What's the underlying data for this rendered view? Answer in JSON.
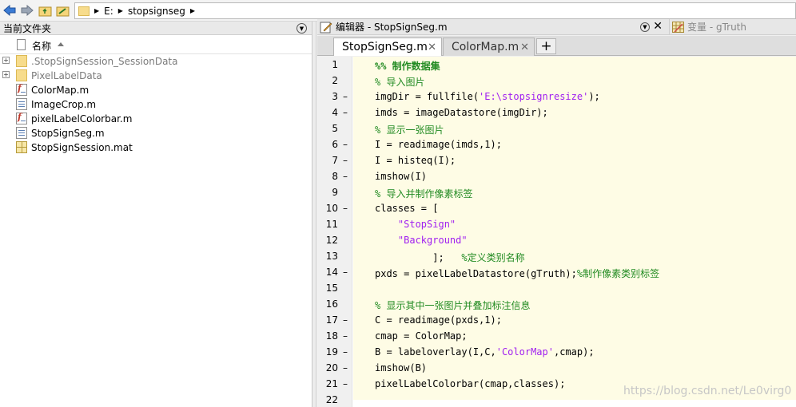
{
  "address_bar": {
    "path": [
      "E:",
      "stopsignseg"
    ]
  },
  "current_folder": {
    "title": "当前文件夹",
    "column_name": "名称",
    "files": [
      {
        "name": ".StopSignSession_SessionData",
        "type": "folder",
        "expandable": true,
        "dim": true
      },
      {
        "name": "PixelLabelData",
        "type": "folder",
        "expandable": true,
        "dim": true
      },
      {
        "name": "ColorMap.m",
        "type": "function-m"
      },
      {
        "name": "ImageCrop.m",
        "type": "script-m"
      },
      {
        "name": "pixelLabelColorbar.m",
        "type": "function-m"
      },
      {
        "name": "StopSignSeg.m",
        "type": "script-m"
      },
      {
        "name": "StopSignSession.mat",
        "type": "mat"
      }
    ]
  },
  "editor": {
    "title": "编辑器 - StopSignSeg.m",
    "tabs": [
      {
        "label": "StopSignSeg.m",
        "active": true
      },
      {
        "label": "ColorMap.m",
        "active": false
      }
    ],
    "add_tab": "+"
  },
  "variables_panel": {
    "title": "变量 - gTruth"
  },
  "code": {
    "lines": [
      {
        "n": "1",
        "dash": "",
        "src": "%% 制作数据集"
      },
      {
        "n": "2",
        "dash": "",
        "src": "% 导入图片"
      },
      {
        "n": "3",
        "dash": "–",
        "src": "imgDir = fullfile('E:\\stopsignresize');"
      },
      {
        "n": "4",
        "dash": "–",
        "src": "imds = imageDatastore(imgDir);"
      },
      {
        "n": "5",
        "dash": "",
        "src": "% 显示一张图片"
      },
      {
        "n": "6",
        "dash": "–",
        "src": "I = readimage(imds,1);"
      },
      {
        "n": "7",
        "dash": "–",
        "src": "I = histeq(I);"
      },
      {
        "n": "8",
        "dash": "–",
        "src": "imshow(I)"
      },
      {
        "n": "9",
        "dash": "",
        "src": "% 导入并制作像素标签"
      },
      {
        "n": "10",
        "dash": "–",
        "src": "classes = ["
      },
      {
        "n": "11",
        "dash": "",
        "src": "    \"StopSign\""
      },
      {
        "n": "12",
        "dash": "",
        "src": "    \"Background\""
      },
      {
        "n": "13",
        "dash": "",
        "src": "          ];   %定义类别名称"
      },
      {
        "n": "14",
        "dash": "–",
        "src": "pxds = pixelLabelDatastore(gTruth);%制作像素类别标签"
      },
      {
        "n": "15",
        "dash": "",
        "src": ""
      },
      {
        "n": "16",
        "dash": "",
        "src": "% 显示其中一张图片并叠加标注信息"
      },
      {
        "n": "17",
        "dash": "–",
        "src": "C = readimage(pxds,1);"
      },
      {
        "n": "18",
        "dash": "–",
        "src": "cmap = ColorMap;"
      },
      {
        "n": "19",
        "dash": "–",
        "src": "B = labeloverlay(I,C,'ColorMap',cmap);"
      },
      {
        "n": "20",
        "dash": "–",
        "src": "imshow(B)"
      },
      {
        "n": "21",
        "dash": "–",
        "src": "pixelLabelColorbar(cmap,classes);"
      },
      {
        "n": "22",
        "dash": "",
        "src": ""
      }
    ]
  },
  "watermark": "https://blog.csdn.net/Le0virg0",
  "colors": {
    "comment": "#228b22",
    "string": "#a020f0",
    "code_bg": "#fefce5"
  }
}
